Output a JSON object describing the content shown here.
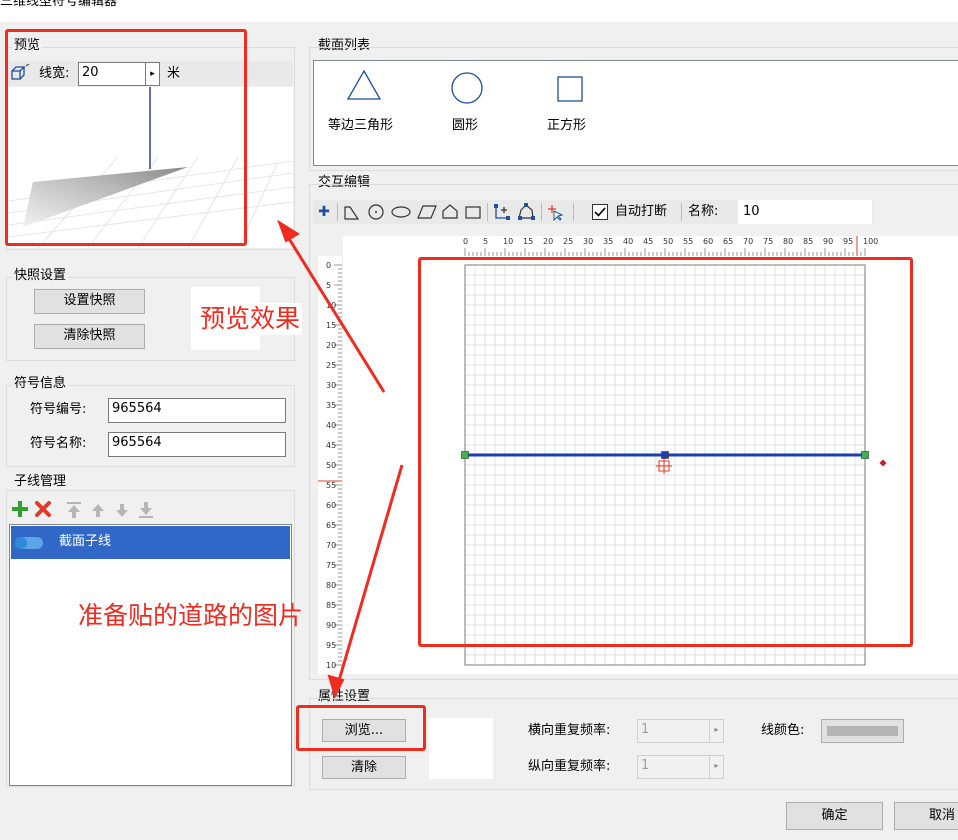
{
  "window": {
    "title": "三维线型符号编辑器"
  },
  "preview": {
    "group_label": "预览",
    "line_width_label": "线宽:",
    "line_width_value": "20",
    "unit": "米"
  },
  "snapshot": {
    "group_label": "快照设置",
    "set_button": "设置快照",
    "clear_button": "清除快照"
  },
  "symbol_info": {
    "group_label": "符号信息",
    "id_label": "符号编号:",
    "id_value": "965564",
    "name_label": "符号名称:",
    "name_value": "965564"
  },
  "sub_lines": {
    "group_label": "子线管理",
    "items": [
      {
        "label": "截面子线",
        "selected": true
      }
    ]
  },
  "sections": {
    "group_label": "截面列表",
    "items": [
      {
        "label": "等边三角形",
        "shape": "triangle"
      },
      {
        "label": "圆形",
        "shape": "circle"
      },
      {
        "label": "正方形",
        "shape": "square"
      }
    ]
  },
  "interactive": {
    "group_label": "交互编辑",
    "auto_break_label": "自动打断",
    "auto_break_checked": true,
    "name_label": "名称:",
    "name_value": "10",
    "ruler_x_ticks": [
      "0",
      "5",
      "10",
      "15",
      "20",
      "25",
      "30",
      "35",
      "40",
      "45",
      "50",
      "55",
      "60",
      "65",
      "70",
      "75",
      "80",
      "85",
      "90",
      "95",
      "100"
    ],
    "ruler_y_ticks": [
      "0",
      "5",
      "10",
      "15",
      "20",
      "25",
      "30",
      "35",
      "40",
      "45",
      "50",
      "55",
      "60",
      "65",
      "70",
      "75",
      "80",
      "85",
      "90",
      "95",
      "10"
    ],
    "line_color": "#1a3fb3"
  },
  "properties": {
    "group_label": "属性设置",
    "browse_button": "浏览...",
    "clear_button": "清除",
    "h_repeat_label": "横向重复频率:",
    "h_repeat_value": "1",
    "v_repeat_label": "纵向重复频率:",
    "v_repeat_value": "1",
    "line_color_label": "线颜色:"
  },
  "footer": {
    "ok_button": "确定",
    "cancel_button": "取消"
  },
  "annotations": {
    "preview_effect": "预览效果",
    "road_image": "准备贴的道路的图片"
  }
}
